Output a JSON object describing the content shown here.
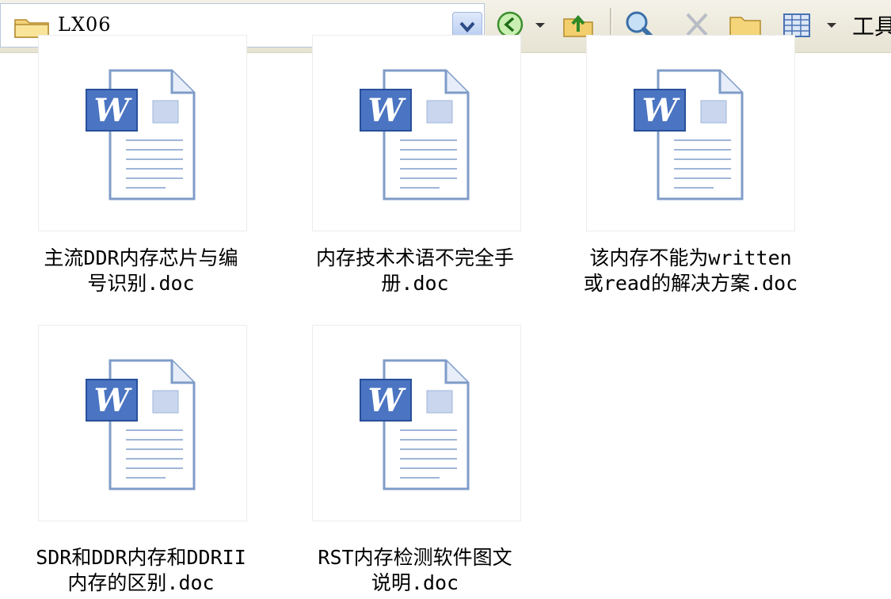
{
  "window": {
    "address": "LX06",
    "tools_label": "工具"
  },
  "toolbar": {
    "icons": [
      "back-icon",
      "dropdown-arrow-icon",
      "up-folder-icon",
      "search-icon",
      "delete-icon",
      "folders-icon",
      "views-icon",
      "dropdown-arrow-icon"
    ]
  },
  "files": [
    {
      "line1": "主流DDR内存芯片与编",
      "line2": "号识别.doc",
      "type": "word-document-icon"
    },
    {
      "line1": "内存技术术语不完全手",
      "line2": "册.doc",
      "type": "word-document-icon"
    },
    {
      "line1": "该内存不能为written",
      "line2": "或read的解决方案.doc",
      "type": "word-document-icon"
    },
    {
      "line1": "SDR和DDR内存和DDRII",
      "line2": "内存的区别.doc",
      "type": "word-document-icon"
    },
    {
      "line1": "RST内存检测软件图文",
      "line2": "说明.doc",
      "type": "word-document-icon"
    }
  ]
}
